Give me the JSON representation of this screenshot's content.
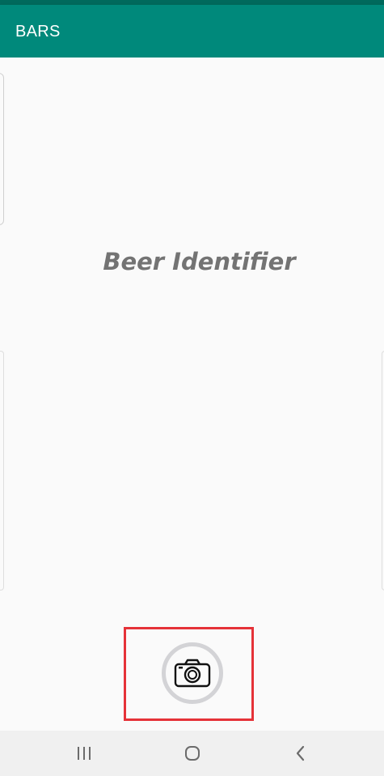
{
  "appbar": {
    "title": "BARS",
    "color": "#00897b",
    "status_color": "#00695c"
  },
  "main": {
    "headline": "Beer Identifier",
    "camera_button_icon": "camera-icon",
    "highlight_color": "#e53238"
  },
  "navbar": {
    "buttons": [
      {
        "icon": "recent-apps-icon"
      },
      {
        "icon": "home-icon"
      },
      {
        "icon": "back-icon"
      }
    ]
  }
}
